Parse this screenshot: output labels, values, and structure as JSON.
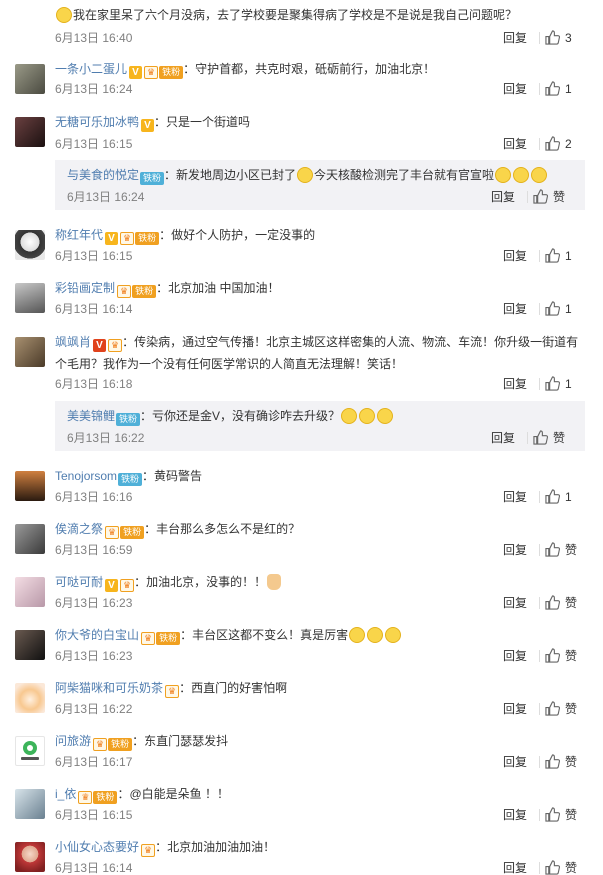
{
  "ui": {
    "reply_label": "回复",
    "like_label": "赞"
  },
  "first": {
    "text": "我在家里呆了六个月没病，去了学校要是聚集得病了学校是不是说是我自己问题呢？",
    "date": "6月13日 16:40",
    "likes": "3"
  },
  "comments": [
    {
      "user": "一条小二蛋儿",
      "text": "：守护首都，共克时艰，砥砺前行，加油北京！",
      "date": "6月13日 16:24",
      "likes": "1",
      "avatar_color": "#6b6b5e"
    },
    {
      "user": "无糖可乐加冰鸭",
      "text": "：只是一个街道吗",
      "date": "6月13日 16:15",
      "likes": "2",
      "avatar_color": "#3a2a2a"
    },
    {
      "user": "与美食的悦定",
      "badge": "铁粉",
      "text": "：新发地周边小区已封了",
      "text2": "今天核酸检测完了丰台就有官宣啦",
      "date": "6月13日 16:24",
      "likes": "赞"
    },
    {
      "user": "称红年代",
      "badge": "铁粉",
      "text": "：做好个人防护，一定没事的",
      "date": "6月13日 16:15",
      "likes": "1",
      "avatar_color": "#d9d9d9"
    },
    {
      "user": "彩铅画定制",
      "badge": "铁粉",
      "text": "：北京加油 中国加油！",
      "date": "6月13日 16:14",
      "likes": "1",
      "avatar_color": "#8a8a8a"
    },
    {
      "user": "飒飒肖",
      "text": "：传染病，通过空气传播！北京主城区这样密集的人流、物流、车流！你升级一街道有个毛用？我作为一个没有任何医学常识的人简直无法理解！笑话！",
      "date": "6月13日 16:18",
      "likes": "1",
      "avatar_color": "#7a6a55"
    },
    {
      "user": "美美锦鲤",
      "badge": "铁粉",
      "text": "：亏你还是金V，没有确诊咋去升级？",
      "date": "6月13日 16:22",
      "likes": "赞"
    },
    {
      "user": "Tenojorsom",
      "badge": "铁粉",
      "text": "：黄码警告",
      "date": "6月13日 16:16",
      "likes": "1",
      "avatar_color": "#5a3820"
    },
    {
      "user": "俟滴之祭",
      "badge": "铁粉",
      "text": "：丰台那么多怎么不是红的？",
      "date": "6月13日 16:59",
      "likes": "赞",
      "avatar_color": "#5a5a5a"
    },
    {
      "user": "可哒可耐",
      "text": "：加油北京，没事的！！",
      "date": "6月13日 16:23",
      "likes": "赞",
      "avatar_color": "#e8c8d0"
    },
    {
      "user": "你大爷的白宝山",
      "badge": "铁粉",
      "text": "：丰台区这都不变么！真是厉害",
      "date": "6月13日 16:23",
      "likes": "赞",
      "avatar_color": "#2a2a2a"
    },
    {
      "user": "阿柴猫咪和可乐奶茶",
      "text": "：西直门的好害怕啊",
      "date": "6月13日 16:22",
      "likes": "赞",
      "avatar_color": "#f0b080"
    },
    {
      "user": "问旅游",
      "badge": "铁粉",
      "text": "：东直门瑟瑟发抖",
      "date": "6月13日 16:17",
      "likes": "赞",
      "avatar_color": "#ffffff",
      "avatar_text": "问旅游"
    },
    {
      "user": "i_依",
      "badge": "铁粉",
      "text": "：@白能是朵鱼 ！！",
      "date": "6月13日 16:15",
      "likes": "赞",
      "avatar_color": "#a8b8c0"
    },
    {
      "user": "小仙女心态要好",
      "text": "：北京加油加油加油！",
      "date": "6月13日 16:14",
      "likes": "赞",
      "avatar_color": "#c04040"
    }
  ]
}
